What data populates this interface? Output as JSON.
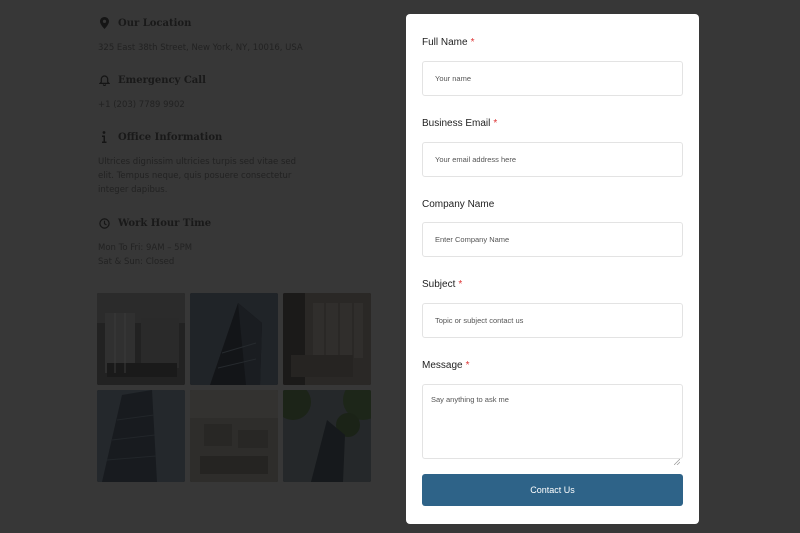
{
  "contact_info": {
    "location": {
      "title": "Our Location",
      "text": "325 East 38th Street, New York, NY, 10016, USA",
      "icon": "map-pin-icon"
    },
    "emergency": {
      "title": "Emergency Call",
      "text": "+1 (203) 7789 9902",
      "icon": "bell-icon"
    },
    "office": {
      "title": "Office Information",
      "lines": [
        "Ultrices dignissim ultricies turpis sed vitae sed",
        "elit. Tempus neque, quis posuere consectetur",
        "integer dapibus."
      ],
      "icon": "info-icon"
    },
    "hours": {
      "title": "Work Hour Time",
      "lines": [
        "Mon To Fri: 9AM – 5PM",
        "Sat & Sun: Closed"
      ],
      "icon": "clock-icon"
    }
  },
  "gallery": [
    "office-interior-photo",
    "skyscraper-photo",
    "lounge-photo",
    "tower-photo",
    "white-office-photo",
    "trees-building-photo"
  ],
  "form": {
    "full_name": {
      "label": "Full Name",
      "required": "*",
      "placeholder": "Your name"
    },
    "email": {
      "label": "Business Email",
      "required": "*",
      "placeholder": "Your email address here"
    },
    "company": {
      "label": "Company Name",
      "placeholder": "Enter Company Name"
    },
    "subject": {
      "label": "Subject",
      "required": "*",
      "placeholder": "Topic or subject contact us"
    },
    "message": {
      "label": "Message",
      "required": "*",
      "placeholder": "Say anything to ask me"
    },
    "submit_label": "Contact Us"
  },
  "colors": {
    "background": "#373737",
    "card": "#ffffff",
    "button": "#2e6388",
    "required": "#dd3333"
  }
}
